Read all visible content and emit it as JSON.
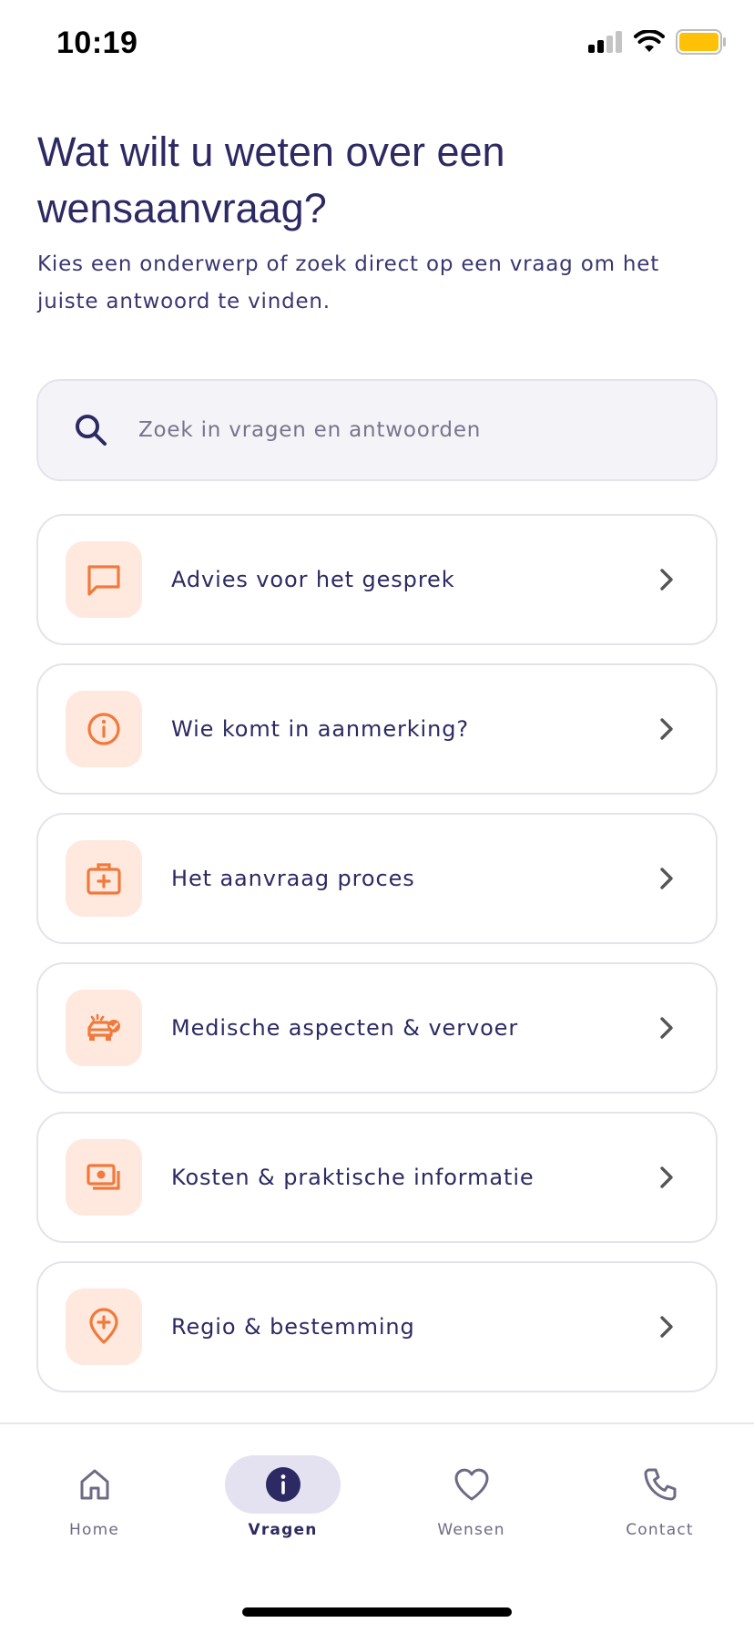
{
  "status_bar": {
    "time": "10:19"
  },
  "header": {
    "title": "Wat wilt u weten over een wensaanvraag?",
    "subtitle": "Kies een onderwerp of zoek direct op een vraag om het juiste antwoord te vinden."
  },
  "search": {
    "placeholder": "Zoek in vragen en antwoorden",
    "value": ""
  },
  "topics": [
    {
      "label": "Advies voor het gesprek",
      "icon": "chat-bubble-icon"
    },
    {
      "label": "Wie komt in aanmerking?",
      "icon": "info-circle-icon"
    },
    {
      "label": "Het aanvraag proces",
      "icon": "medical-bag-icon"
    },
    {
      "label": "Medische aspecten & vervoer",
      "icon": "ambulance-check-icon"
    },
    {
      "label": "Kosten & praktische informatie",
      "icon": "money-icon"
    },
    {
      "label": "Regio & bestemming",
      "icon": "location-plus-icon"
    }
  ],
  "tab_bar": {
    "tabs": [
      {
        "label": "Home",
        "icon": "home-icon",
        "active": false
      },
      {
        "label": "Vragen",
        "icon": "info-icon",
        "active": true
      },
      {
        "label": "Wensen",
        "icon": "heart-icon",
        "active": false
      },
      {
        "label": "Contact",
        "icon": "phone-icon",
        "active": false
      }
    ]
  },
  "colors": {
    "primary": "#2d2a63",
    "accent": "#f07a3c",
    "accent_bg": "#ffe8de",
    "border": "#e4e3ec",
    "battery": "#ffc107"
  }
}
